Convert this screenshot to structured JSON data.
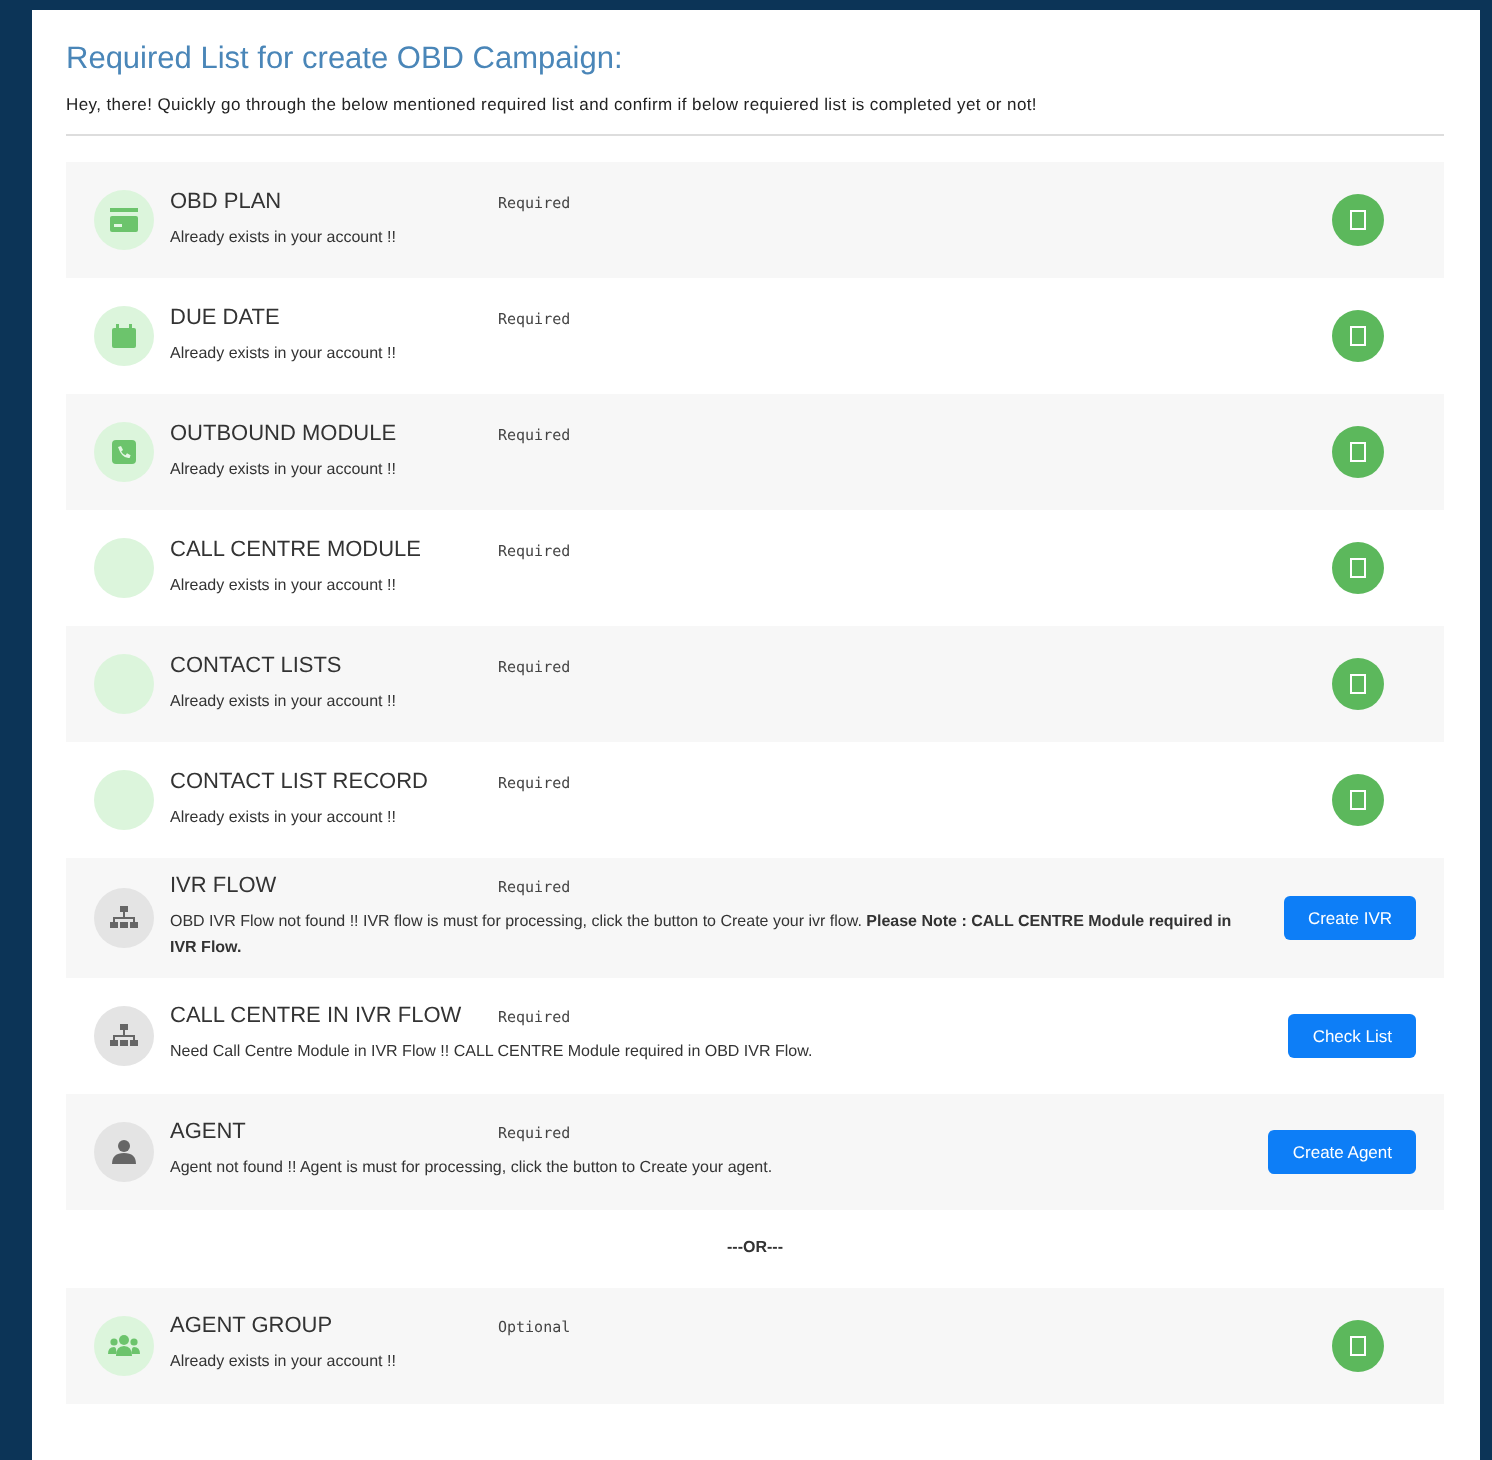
{
  "title": "Required List for create OBD Campaign:",
  "intro": "Hey, there! Quickly go through the below mentioned required list and confirm if below requiered list is completed yet or not!",
  "required_items": [
    {
      "name": "OBD PLAN",
      "tag": "Required",
      "message": "Already exists in your account !!",
      "exists": true,
      "kind": "done"
    },
    {
      "name": "DUE DATE",
      "tag": "Required",
      "message": "Already exists in your account !!",
      "exists": true,
      "kind": "done"
    },
    {
      "name": "OUTBOUND MODULE",
      "tag": "Required",
      "message": "Already exists in your account !!",
      "exists": true,
      "kind": "done"
    },
    {
      "name": "CALL CENTRE MODULE",
      "tag": "Required",
      "message": "Already exists in your account !!",
      "exists": true,
      "kind": "done"
    },
    {
      "name": "CONTACT LISTS",
      "tag": "Required",
      "message": "Already exists in your account !!",
      "exists": true,
      "kind": "done"
    },
    {
      "name": "CONTACT LIST RECORD",
      "tag": "Required",
      "message": "Already exists in your account !!",
      "exists": true,
      "kind": "done"
    },
    {
      "name": "IVR FLOW",
      "tag": "Required",
      "message": "OBD IVR Flow not found !! IVR flow is must for processing, click the button to Create your ivr flow. **Please Note : CALL CENTRE Module required in IVR Flow.**",
      "exists": false,
      "kind": "action",
      "button": "Create IVR"
    },
    {
      "name": "CALL CENTRE IN IVR FLOW",
      "tag": "Required",
      "message": "Need Call Centre Module in IVR Flow !! CALL CENTRE Module required in OBD IVR Flow.",
      "exists": false,
      "kind": "action",
      "button": "Check List"
    },
    {
      "name": "AGENT",
      "tag": "Required",
      "message": "Agent not found !! Agent is must for processing, click the button to Create your agent.",
      "exists": false,
      "kind": "action",
      "button": "Create Agent"
    }
  ],
  "separator": "---OR---",
  "optional_items": [
    {
      "name": "AGENT GROUP",
      "tag": "Optional",
      "message": "Already exists in your account !!",
      "exists": true,
      "kind": "done"
    }
  ]
}
